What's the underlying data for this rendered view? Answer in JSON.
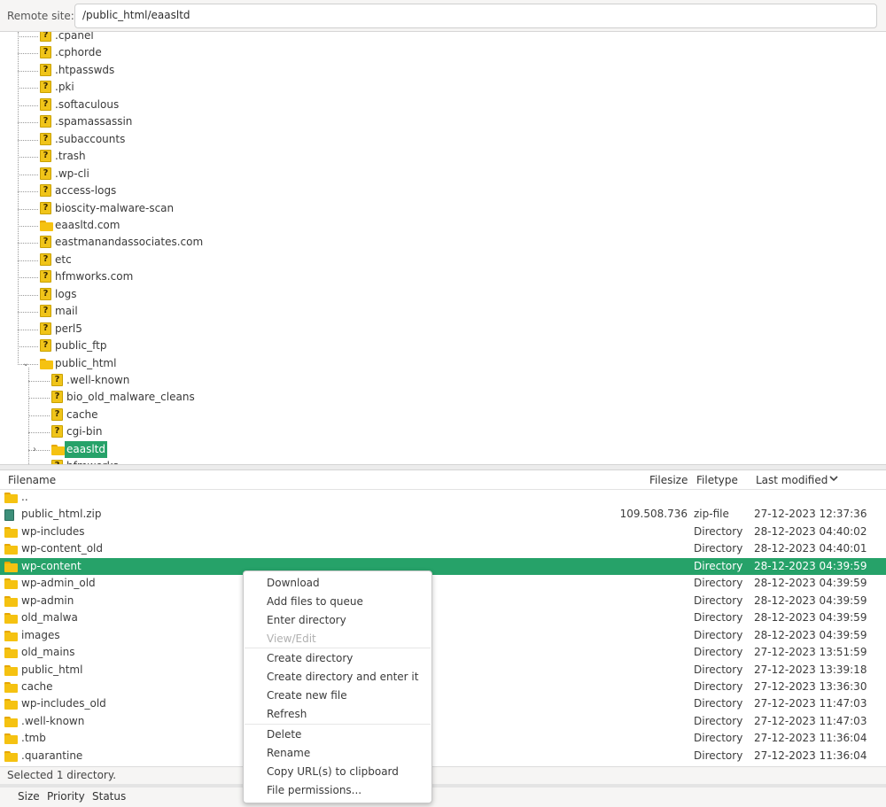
{
  "remote_site": {
    "label": "Remote site:",
    "path": "/public_html/eaasltd"
  },
  "tree": {
    "items": [
      {
        "label": ".cpanel",
        "type": "unknown"
      },
      {
        "label": ".cphorde",
        "type": "unknown"
      },
      {
        "label": ".htpasswds",
        "type": "unknown"
      },
      {
        "label": ".pki",
        "type": "unknown"
      },
      {
        "label": ".softaculous",
        "type": "unknown"
      },
      {
        "label": ".spamassassin",
        "type": "unknown"
      },
      {
        "label": ".subaccounts",
        "type": "unknown"
      },
      {
        "label": ".trash",
        "type": "unknown"
      },
      {
        "label": ".wp-cli",
        "type": "unknown"
      },
      {
        "label": "access-logs",
        "type": "unknown"
      },
      {
        "label": "bioscity-malware-scan",
        "type": "unknown"
      },
      {
        "label": "eaasltd.com",
        "type": "folder"
      },
      {
        "label": "eastmanandassociates.com",
        "type": "unknown"
      },
      {
        "label": "etc",
        "type": "unknown"
      },
      {
        "label": "hfmworks.com",
        "type": "unknown"
      },
      {
        "label": "logs",
        "type": "unknown"
      },
      {
        "label": "mail",
        "type": "unknown"
      },
      {
        "label": "perl5",
        "type": "unknown"
      },
      {
        "label": "public_ftp",
        "type": "unknown"
      },
      {
        "label": "public_html",
        "type": "folder",
        "expanded": true
      },
      {
        "label": ".well-known",
        "type": "unknown"
      },
      {
        "label": "bio_old_malware_cleans",
        "type": "unknown"
      },
      {
        "label": "cache",
        "type": "unknown"
      },
      {
        "label": "cgi-bin",
        "type": "unknown"
      },
      {
        "label": "eaasltd",
        "type": "folder",
        "selected": true
      },
      {
        "label": "hfmworks",
        "type": "unknown"
      }
    ]
  },
  "file_list": {
    "columns": {
      "filename": "Filename",
      "filesize": "Filesize",
      "filetype": "Filetype",
      "last_modified": "Last modified"
    },
    "sort_icon": "chevron-down-icon",
    "rows": [
      {
        "name": "..",
        "size": "",
        "type": "",
        "modified": "",
        "icon": "folder"
      },
      {
        "name": "public_html.zip",
        "size": "109.508.736",
        "type": "zip-file",
        "modified": "27-12-2023 12:37:36",
        "icon": "zip"
      },
      {
        "name": "wp-includes",
        "size": "",
        "type": "Directory",
        "modified": "28-12-2023 04:40:02",
        "icon": "folder"
      },
      {
        "name": "wp-content_old",
        "size": "",
        "type": "Directory",
        "modified": "28-12-2023 04:40:01",
        "icon": "folder"
      },
      {
        "name": "wp-content",
        "size": "",
        "type": "Directory",
        "modified": "28-12-2023 04:39:59",
        "icon": "folder",
        "selected": true
      },
      {
        "name": "wp-admin_old",
        "size": "",
        "type": "Directory",
        "modified": "28-12-2023 04:39:59",
        "icon": "folder"
      },
      {
        "name": "wp-admin",
        "size": "",
        "type": "Directory",
        "modified": "28-12-2023 04:39:59",
        "icon": "folder"
      },
      {
        "name": "old_malwa",
        "size": "",
        "type": "Directory",
        "modified": "28-12-2023 04:39:59",
        "icon": "folder"
      },
      {
        "name": "images",
        "size": "",
        "type": "Directory",
        "modified": "28-12-2023 04:39:59",
        "icon": "folder"
      },
      {
        "name": "old_mains",
        "size": "",
        "type": "Directory",
        "modified": "27-12-2023 13:51:59",
        "icon": "folder"
      },
      {
        "name": "public_html",
        "size": "",
        "type": "Directory",
        "modified": "27-12-2023 13:39:18",
        "icon": "folder"
      },
      {
        "name": "cache",
        "size": "",
        "type": "Directory",
        "modified": "27-12-2023 13:36:30",
        "icon": "folder"
      },
      {
        "name": "wp-includes_old",
        "size": "",
        "type": "Directory",
        "modified": "27-12-2023 11:47:03",
        "icon": "folder"
      },
      {
        "name": ".well-known",
        "size": "",
        "type": "Directory",
        "modified": "27-12-2023 11:47:03",
        "icon": "folder"
      },
      {
        "name": ".tmb",
        "size": "",
        "type": "Directory",
        "modified": "27-12-2023 11:36:04",
        "icon": "folder"
      },
      {
        "name": ".quarantine",
        "size": "",
        "type": "Directory",
        "modified": "27-12-2023 11:36:04",
        "icon": "folder"
      }
    ]
  },
  "status": {
    "text": "Selected 1 directory."
  },
  "queue_tabs": {
    "size": "Size",
    "priority": "Priority",
    "status": "Status"
  },
  "context_menu": {
    "items": [
      {
        "label": "Download",
        "enabled": true
      },
      {
        "label": "Add files to queue",
        "enabled": true
      },
      {
        "label": "Enter directory",
        "enabled": true
      },
      {
        "label": "View/Edit",
        "enabled": false
      },
      {
        "label": "Create directory",
        "enabled": true
      },
      {
        "label": "Create directory and enter it",
        "enabled": true
      },
      {
        "label": "Create new file",
        "enabled": true
      },
      {
        "label": "Refresh",
        "enabled": true
      },
      {
        "label": "Delete",
        "enabled": true
      },
      {
        "label": "Rename",
        "enabled": true
      },
      {
        "label": "Copy URL(s) to clipboard",
        "enabled": true
      },
      {
        "label": "File permissions...",
        "enabled": true
      }
    ]
  },
  "colors": {
    "selection": "#26a269",
    "folder": "#f5c211",
    "unknown_icon": "#f0c419"
  }
}
